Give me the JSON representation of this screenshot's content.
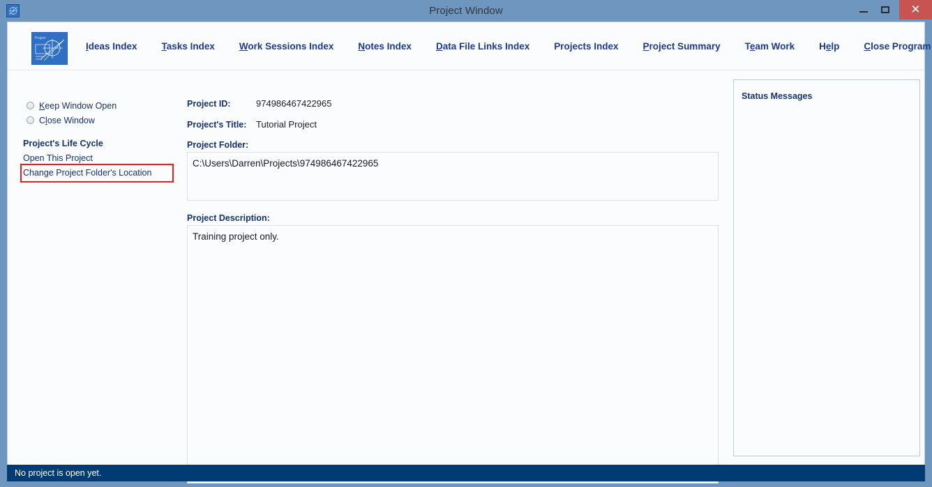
{
  "window": {
    "title": "Project Window",
    "icon": "project-app-icon",
    "controls": {
      "minimize": "minimize-button",
      "maximize": "maximize-button",
      "close": "close-button",
      "close_glyph": "✕",
      "close_color": "#c75450"
    },
    "frame_color": "#6f96bf",
    "client_color": "#fbfcfe"
  },
  "header": {
    "logo_label": "Project",
    "menu": [
      {
        "prefix": "",
        "accel": "I",
        "suffix": "deas Index",
        "name": "ideas-index"
      },
      {
        "prefix": "",
        "accel": "T",
        "suffix": "asks Index",
        "name": "tasks-index"
      },
      {
        "prefix": "",
        "accel": "W",
        "suffix": "ork Sessions Index",
        "name": "work-sessions-index"
      },
      {
        "prefix": "",
        "accel": "N",
        "suffix": "otes Index",
        "name": "notes-index"
      },
      {
        "prefix": "",
        "accel": "D",
        "suffix": "ata File Links Index",
        "name": "data-file-links-index"
      },
      {
        "prefix": "Projects Index",
        "accel": "",
        "suffix": "",
        "name": "projects-index"
      },
      {
        "prefix": "",
        "accel": "P",
        "suffix": "roject Summary",
        "name": "project-summary"
      },
      {
        "prefix": "T",
        "accel": "e",
        "suffix": "am Work",
        "name": "team-work"
      },
      {
        "prefix": "H",
        "accel": "e",
        "suffix": "lp",
        "name": "help"
      },
      {
        "prefix": "",
        "accel": "C",
        "suffix": "lose Program",
        "name": "close-program"
      }
    ]
  },
  "sidebar": {
    "radios": [
      {
        "prefix": "",
        "accel": "K",
        "suffix": "eep Window Open",
        "selected": false,
        "name": "keep-window-open"
      },
      {
        "prefix": "C",
        "accel": "l",
        "suffix": "ose Window",
        "selected": false,
        "name": "close-window"
      }
    ],
    "section_title": "Project's Life Cycle",
    "links": [
      {
        "label": "Open This Project",
        "name": "open-this-project",
        "highlighted": false
      },
      {
        "label": "Change Project Folder's Location",
        "name": "change-project-folder-location",
        "highlighted": true
      }
    ],
    "highlight_color": "#ee1b1b"
  },
  "form": {
    "project_id_label": "Project ID:",
    "project_id_value": "974986467422965",
    "project_title_label": "Project's Title:",
    "project_title_value": "Tutorial Project",
    "project_folder_label": "Project Folder:",
    "project_folder_value": "C:\\Users\\Darren\\Projects\\974986467422965",
    "project_description_label": "Project Description:",
    "project_description_value": "Training project only."
  },
  "status_panel": {
    "legend": "Status Messages",
    "messages": ""
  },
  "statusbar": {
    "text": "No project is open yet.",
    "background": "#003c73"
  }
}
